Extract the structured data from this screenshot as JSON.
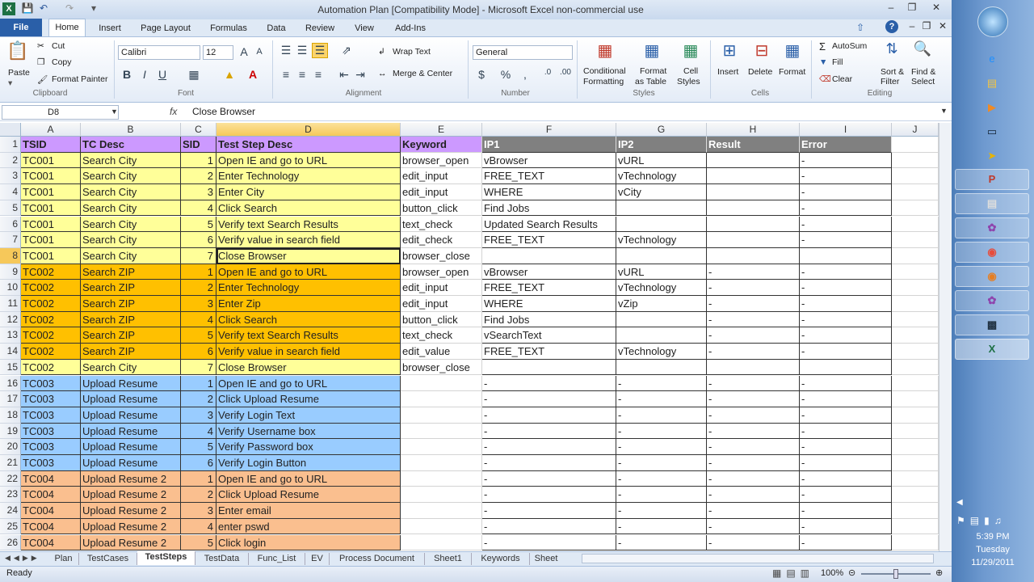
{
  "window": {
    "title": "Automation Plan  [Compatibility Mode]  -  Microsoft Excel non-commercial use"
  },
  "tabs": [
    "File",
    "Home",
    "Insert",
    "Page Layout",
    "Formulas",
    "Data",
    "Review",
    "View",
    "Add-Ins"
  ],
  "clipboard": {
    "paste": "Paste",
    "cut": "Cut",
    "copy": "Copy",
    "format_painter": "Format Painter",
    "label": "Clipboard"
  },
  "font": {
    "name": "Calibri",
    "size": "12",
    "label": "Font"
  },
  "alignment": {
    "wrap": "Wrap Text",
    "merge": "Merge & Center",
    "label": "Alignment"
  },
  "number": {
    "format": "General",
    "label": "Number"
  },
  "styles": {
    "cond": [
      "Conditional",
      "Formatting"
    ],
    "table": [
      "Format",
      "as Table"
    ],
    "cell": [
      "Cell",
      "Styles"
    ],
    "label": "Styles"
  },
  "cells": {
    "insert": "Insert",
    "delete": "Delete",
    "format": "Format",
    "label": "Cells"
  },
  "editing": {
    "autosum": "AutoSum",
    "fill": "Fill",
    "clear": "Clear",
    "sort": [
      "Sort &",
      "Filter"
    ],
    "find": [
      "Find &",
      "Select"
    ],
    "label": "Editing"
  },
  "formula_bar": {
    "name_box": "D8",
    "fx": "fx",
    "content": "Close Browser"
  },
  "columns": [
    "A",
    "B",
    "C",
    "D",
    "E",
    "F",
    "G",
    "H",
    "I",
    "J"
  ],
  "header_row": [
    "TSID",
    "TC Desc",
    "SID",
    "Test Step Desc",
    "Keyword",
    "IP1",
    "IP2",
    "Result",
    "Error"
  ],
  "rows": [
    [
      "TC001",
      "Search City",
      "1",
      "Open IE and go to URL",
      "browser_open",
      "vBrowser",
      "vURL",
      "",
      "-"
    ],
    [
      "TC001",
      "Search City",
      "2",
      "Enter Technology",
      "edit_input",
      "FREE_TEXT",
      "vTechnology",
      "",
      "-"
    ],
    [
      "TC001",
      "Search City",
      "3",
      "Enter City",
      "edit_input",
      "WHERE",
      "vCity",
      "",
      "-"
    ],
    [
      "TC001",
      "Search City",
      "4",
      "Click Search",
      "button_click",
      "Find Jobs",
      "",
      "",
      "-"
    ],
    [
      "TC001",
      "Search City",
      "5",
      "Verify text Search Results",
      "text_check",
      "Updated Search Results",
      "",
      "",
      "-"
    ],
    [
      "TC001",
      "Search City",
      "6",
      "Verify value in search field",
      "edit_check",
      "FREE_TEXT",
      "vTechnology",
      "",
      "-"
    ],
    [
      "TC001",
      "Search City",
      "7",
      "Close Browser",
      "browser_close",
      "",
      "",
      "",
      ""
    ],
    [
      "TC002",
      "Search ZIP",
      "1",
      "Open IE and go to URL",
      "browser_open",
      "vBrowser",
      "vURL",
      "-",
      "-"
    ],
    [
      "TC002",
      "Search ZIP",
      "2",
      "Enter Technology",
      "edit_input",
      "FREE_TEXT",
      "vTechnology",
      "-",
      "-"
    ],
    [
      "TC002",
      "Search ZIP",
      "3",
      "Enter Zip",
      "edit_input",
      "WHERE",
      "vZip",
      "-",
      "-"
    ],
    [
      "TC002",
      "Search ZIP",
      "4",
      "Click Search",
      "button_click",
      "Find Jobs",
      "",
      "-",
      "-"
    ],
    [
      "TC002",
      "Search ZIP",
      "5",
      "Verify text Search Results",
      "text_check",
      "vSearchText",
      "",
      "-",
      "-"
    ],
    [
      "TC002",
      "Search ZIP",
      "6",
      "Verify value in search field",
      "edit_value",
      "FREE_TEXT",
      "vTechnology",
      "-",
      "-"
    ],
    [
      "TC002",
      "Search City",
      "7",
      "Close Browser",
      "browser_close",
      "",
      "",
      "",
      ""
    ],
    [
      "TC003",
      "Upload Resume",
      "1",
      "Open IE and go to URL",
      "",
      "-",
      "-",
      "-",
      "-"
    ],
    [
      "TC003",
      "Upload Resume",
      "2",
      "Click Upload Resume",
      "",
      "-",
      "-",
      "-",
      "-"
    ],
    [
      "TC003",
      "Upload Resume",
      "3",
      "Verify Login Text",
      "",
      "-",
      "-",
      "-",
      "-"
    ],
    [
      "TC003",
      "Upload Resume",
      "4",
      "Verify Username box",
      "",
      "-",
      "-",
      "-",
      "-"
    ],
    [
      "TC003",
      "Upload Resume",
      "5",
      "Verify Password box",
      "",
      "-",
      "-",
      "-",
      "-"
    ],
    [
      "TC003",
      "Upload Resume",
      "6",
      "Verify Login Button",
      "",
      "-",
      "-",
      "-",
      "-"
    ],
    [
      "TC004",
      "Upload Resume 2",
      "1",
      "Open IE and go to URL",
      "",
      "-",
      "-",
      "-",
      "-"
    ],
    [
      "TC004",
      "Upload Resume 2",
      "2",
      "Click Upload Resume",
      "",
      "-",
      "-",
      "-",
      "-"
    ],
    [
      "TC004",
      "Upload Resume 2",
      "3",
      "Enter email",
      "",
      "-",
      "-",
      "-",
      "-"
    ],
    [
      "TC004",
      "Upload Resume 2",
      "4",
      "enter pswd",
      "",
      "-",
      "-",
      "-",
      "-"
    ],
    [
      "TC004",
      "Upload Resume 2",
      "5",
      "Click login",
      "",
      "-",
      "-",
      "-",
      "-"
    ]
  ],
  "sheet_tabs": [
    "Plan",
    "TestCases",
    "TestSteps",
    "TestData",
    "Func_List",
    "EV",
    "Process Document",
    "Sheet1",
    "Keywords",
    "Sheet"
  ],
  "status": {
    "ready": "Ready",
    "zoom": "100%"
  },
  "clock": {
    "time": "5:39 PM",
    "day": "Tuesday",
    "date": "11/29/2011"
  },
  "colors": {
    "yellow": "#ffff99",
    "orange": "#ffc000",
    "blue": "#99ccff",
    "peach": "#fabf8f",
    "purple": "#cc99ff",
    "gray": "#808080"
  }
}
